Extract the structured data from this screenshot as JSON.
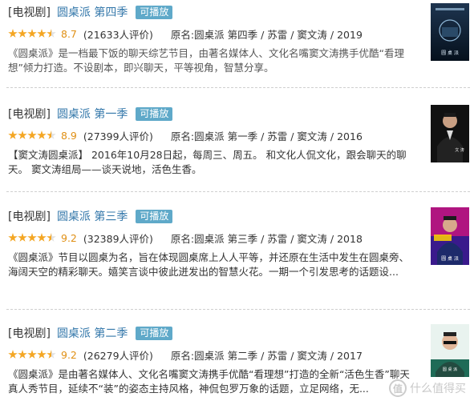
{
  "items": [
    {
      "type": "[电视剧]",
      "name": "圆桌派 第四季",
      "badge": "可播放",
      "score": "8.7",
      "stars": 4.5,
      "votes": "(21633人评价)",
      "original": "原名:圆桌派 第四季 / 苏雷 / 窦文涛 / 2019",
      "desc": "《圆桌派》是一档最下饭的聊天综艺节目，由著名媒体人、文化名嘴窦文涛携手优酷“看理想”倾力打造。不设剧本，即兴聊天，平等视角，智慧分享。",
      "poster_text": "圆 桌 派"
    },
    {
      "type": "[电视剧]",
      "name": "圆桌派 第一季",
      "badge": "可播放",
      "score": "8.9",
      "stars": 4.5,
      "votes": "(27399人评价)",
      "original": "原名:圆桌派 第一季 / 苏雷 / 窦文涛 / 2016",
      "desc": "【窦文涛圆桌派】 2016年10月28日起，每周三、周五。 和文化人侃文化，跟会聊天的聊天。 窦文涛组局——谈天说地，活色生香。",
      "poster_text": "文 涛"
    },
    {
      "type": "[电视剧]",
      "name": "圆桌派 第三季",
      "badge": "可播放",
      "score": "9.2",
      "stars": 4.5,
      "votes": "(32389人评价)",
      "original": "原名:圆桌派 第三季 / 苏雷 / 窦文涛 / 2018",
      "desc": "《圆桌派》节目以圆桌为名，旨在体现圆桌席上人人平等，并还原在生活中发生在圆桌旁、海阔天空的精彩聊天。嬉笑言谈中彼此迸发出的智慧火花。一期一个引发思考的话题设...",
      "poster_text": "圆 桌 派"
    },
    {
      "type": "[电视剧]",
      "name": "圆桌派 第二季",
      "badge": "可播放",
      "score": "9.2",
      "stars": 4.5,
      "votes": "(26279人评价)",
      "original": "原名:圆桌派 第二季 / 苏雷 / 窦文涛 / 2017",
      "desc": "《圆桌派》是由著名媒体人、文化名嘴窦文涛携手优酷“看理想”打造的全新“活色生香”聊天真人秀节目，延续不“装”的姿态主持风格，神侃包罗万象的话题，立足网络，无...",
      "poster_text": "圆 桌 派"
    }
  ],
  "watermark": {
    "logo": "值",
    "text": "什么值得买"
  }
}
